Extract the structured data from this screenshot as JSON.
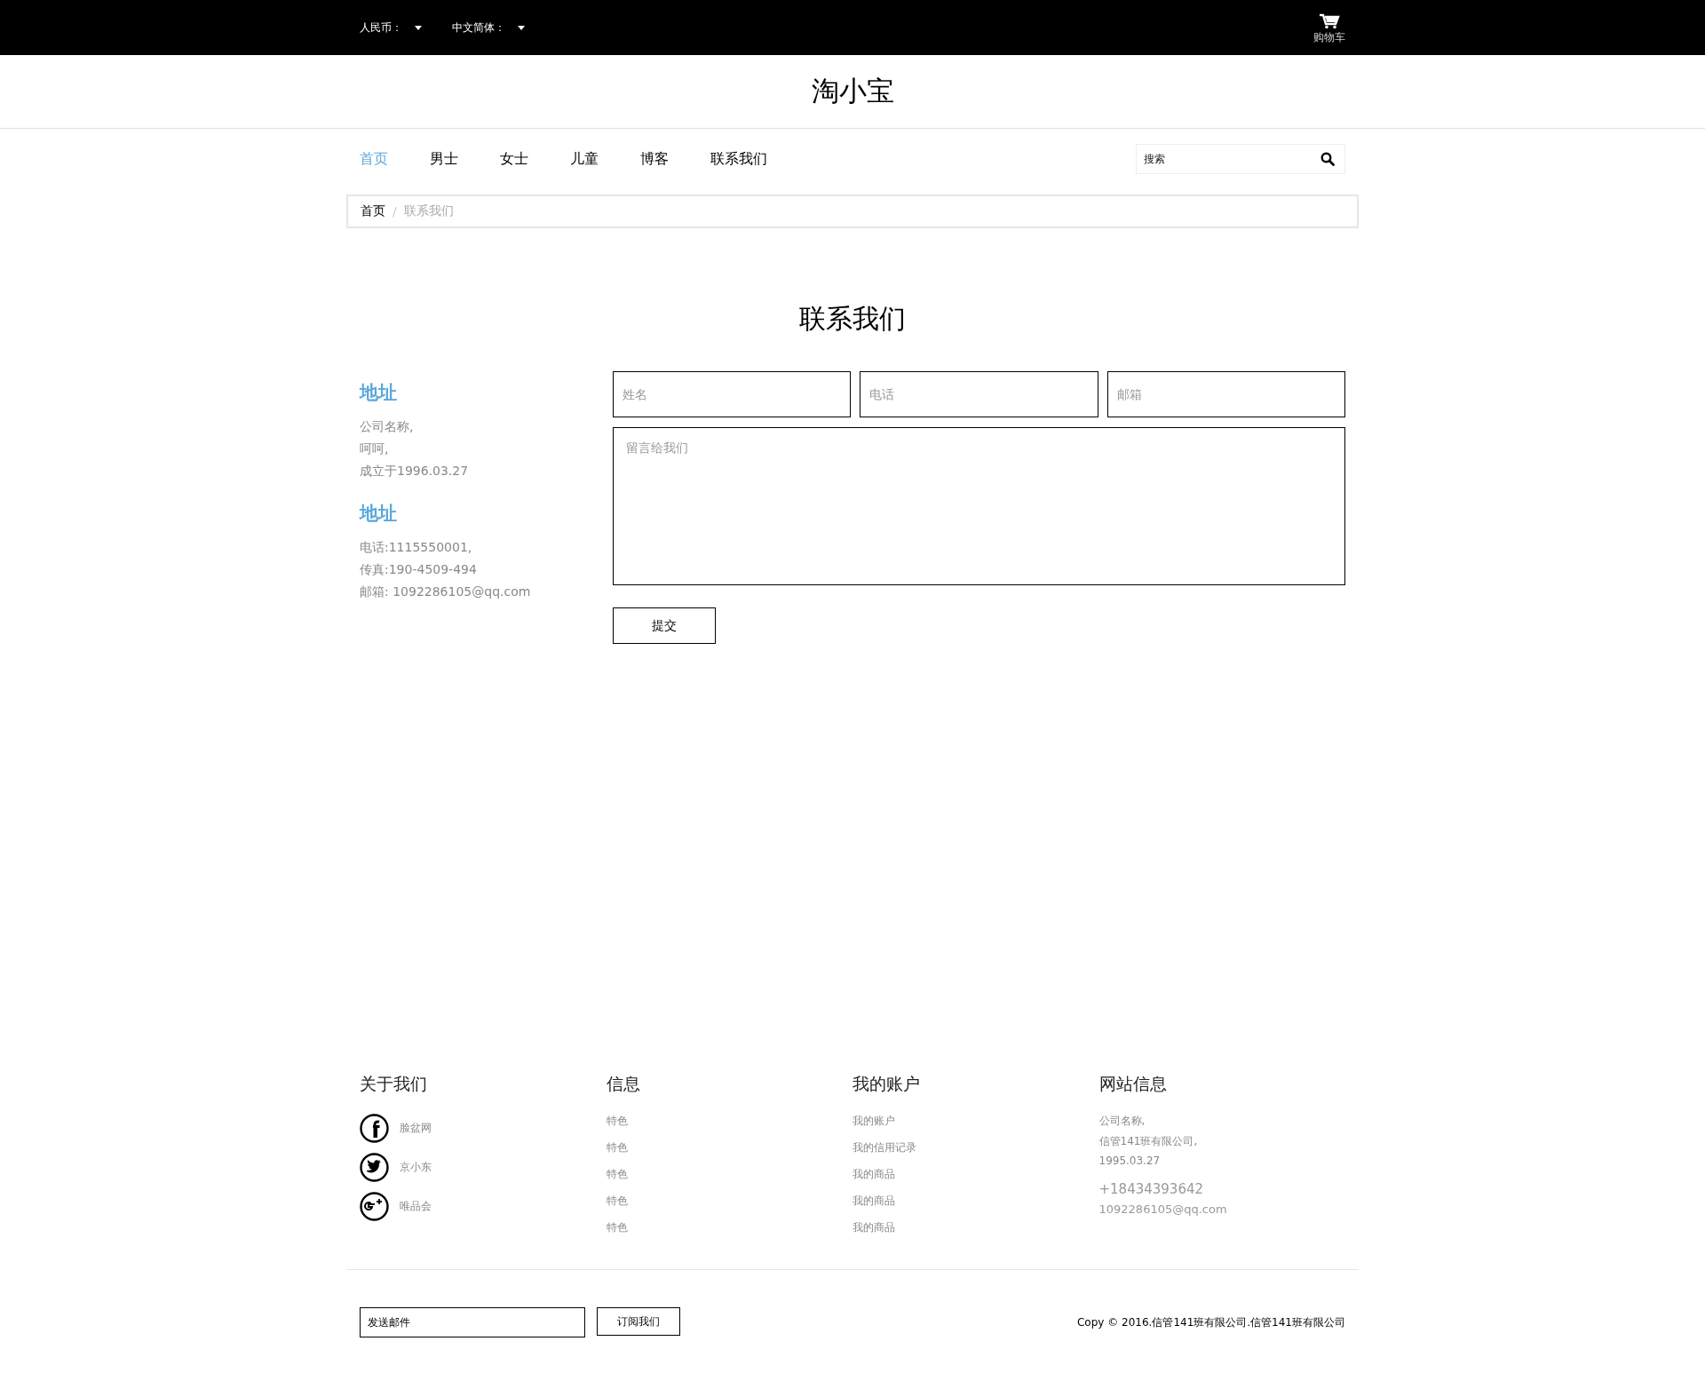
{
  "top_bar": {
    "dropdowns": [
      {
        "label": "人民币："
      },
      {
        "label": "中文简体："
      }
    ],
    "cart": {
      "label": "购物车"
    }
  },
  "header": {
    "logo": "淘小宝"
  },
  "nav": {
    "items": [
      {
        "label": "首页",
        "selected": true
      },
      {
        "label": "男士",
        "selected": false
      },
      {
        "label": "女士",
        "selected": false
      },
      {
        "label": "儿童",
        "selected": false
      },
      {
        "label": "博客",
        "selected": false
      },
      {
        "label": "联系我们",
        "selected": false
      }
    ],
    "search": {
      "placeholder": "搜索"
    }
  },
  "breadcrumb": {
    "separator": "/",
    "items": [
      {
        "label": "首页",
        "current": false
      },
      {
        "label": "联系我们",
        "current": true
      }
    ]
  },
  "page_title": "联系我们",
  "contact_info": [
    {
      "heading": "地址",
      "lines": [
        "公司名称,",
        "呵呵,",
        "成立于1996.03.27"
      ]
    },
    {
      "heading": "地址",
      "lines": [
        "电话:1115550001,",
        "传真:190-4509-494",
        "邮箱: 1092286105@qq.com"
      ]
    }
  ],
  "form": {
    "fields": [
      {
        "placeholder": "姓名"
      },
      {
        "placeholder": "电话"
      },
      {
        "placeholder": "邮箱"
      }
    ],
    "message_placeholder": "留言给我们",
    "submit": "提交"
  },
  "footer": {
    "columns": [
      {
        "heading": "关于我们",
        "kind": "social",
        "items": [
          {
            "label": "脸盆网",
            "kind": "facebook"
          },
          {
            "label": "京小东",
            "kind": "twitter"
          },
          {
            "label": "唯品会",
            "kind": "gplus"
          }
        ]
      },
      {
        "heading": "信息",
        "kind": "links",
        "items": [
          {
            "label": "特色"
          },
          {
            "label": "特色"
          },
          {
            "label": "特色"
          },
          {
            "label": "特色"
          },
          {
            "label": "特色"
          }
        ]
      },
      {
        "heading": "我的账户",
        "kind": "links",
        "items": [
          {
            "label": "我的账户"
          },
          {
            "label": "我的信用记录"
          },
          {
            "label": "我的商品"
          },
          {
            "label": "我的商品"
          },
          {
            "label": "我的商品"
          }
        ]
      },
      {
        "heading": "网站信息",
        "kind": "info",
        "lines": [
          "公司名称,",
          "信管141班有限公司,",
          "1995.03.27"
        ],
        "phone": "+18434393642",
        "email": "1092286105@qq.com"
      }
    ],
    "newsletter": {
      "value": "发送邮件",
      "button": "订阅我们"
    },
    "copyright": "Copy © 2016.信管141班有限公司.信管141班有限公司"
  }
}
